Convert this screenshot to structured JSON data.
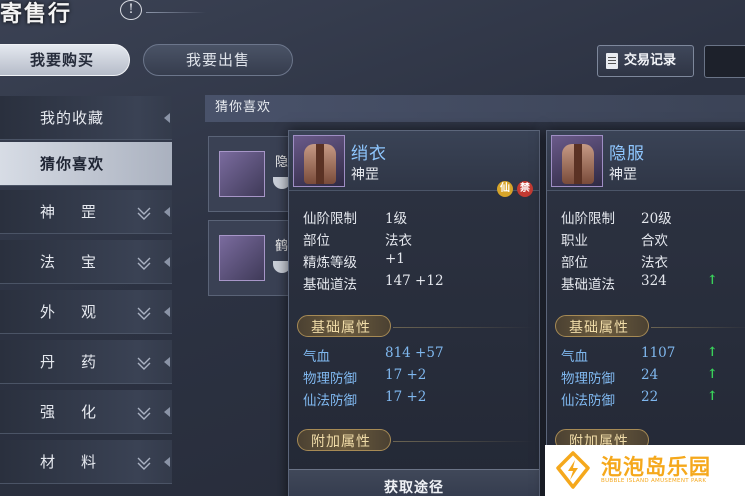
{
  "header": {
    "title": "寄售行",
    "help_label": "!"
  },
  "tabs": {
    "buy": "我要购买",
    "sell": "我要出售"
  },
  "toolbar": {
    "record_label": "交易记录"
  },
  "sidebar": {
    "items": [
      {
        "label": "我的收藏"
      },
      {
        "label": "猜你喜欢"
      },
      {
        "label": "神罡"
      },
      {
        "label": "法宝"
      },
      {
        "label": "外观"
      },
      {
        "label": "丹药"
      },
      {
        "label": "强化"
      },
      {
        "label": "材料"
      }
    ]
  },
  "content": {
    "header": "猜你喜欢",
    "rows": [
      {
        "name": "隐"
      },
      {
        "name": "鹤"
      }
    ]
  },
  "card1": {
    "name": "绡衣",
    "type": "神罡",
    "stats": [
      {
        "label": "仙阶限制",
        "value": "1级"
      },
      {
        "label": "部位",
        "value": "法衣"
      },
      {
        "label": "精炼等级",
        "value": "+1"
      },
      {
        "label": "基础道法",
        "value": "147 +12"
      }
    ],
    "section_base": "基础属性",
    "base_attrs": [
      {
        "label": "气血",
        "value": "814 +57"
      },
      {
        "label": "物理防御",
        "value": "17 +2"
      },
      {
        "label": "仙法防御",
        "value": "17 +2"
      }
    ],
    "section_extra": "附加属性",
    "obtain_label": "获取途径"
  },
  "card2": {
    "name": "隐服",
    "type": "神罡",
    "stats": [
      {
        "label": "仙阶限制",
        "value": "20级"
      },
      {
        "label": "职业",
        "value": "合欢"
      },
      {
        "label": "部位",
        "value": "法衣"
      },
      {
        "label": "基础道法",
        "value": "324"
      }
    ],
    "section_base": "基础属性",
    "base_attrs": [
      {
        "label": "气血",
        "value": "1107"
      },
      {
        "label": "物理防御",
        "value": "24"
      },
      {
        "label": "仙法防御",
        "value": "22"
      }
    ],
    "section_extra": "附加属性",
    "up_arrow": "↑"
  },
  "watermark": {
    "text": "泡泡岛乐园",
    "sub": "BUBBLE ISLAND AMUSEMENT PARK"
  },
  "colors": {
    "accent_blue": "#8fc7ff",
    "up_green": "#39d15a",
    "gold": "#f0dca8",
    "watermark": "#f5a81c"
  }
}
